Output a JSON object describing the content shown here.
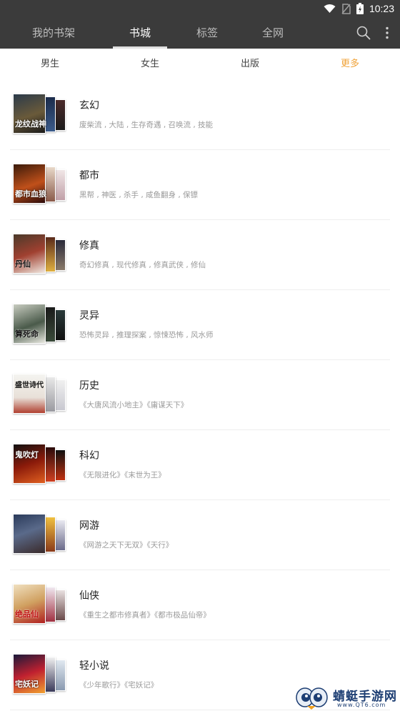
{
  "status_bar": {
    "time": "10:23"
  },
  "nav": {
    "tabs": [
      {
        "label": "我的书架",
        "active": false
      },
      {
        "label": "书城",
        "active": true
      },
      {
        "label": "标签",
        "active": false
      },
      {
        "label": "全网",
        "active": false
      }
    ],
    "actions": [
      "search-icon",
      "more-vert-icon"
    ]
  },
  "categories": {
    "tabs": [
      {
        "label": "男生"
      },
      {
        "label": "女生"
      },
      {
        "label": "出版"
      },
      {
        "label": "更多"
      }
    ]
  },
  "genres": [
    {
      "title": "玄幻",
      "tags": "废柴流 , 大陆 , 生存奇遇 , 召唤流 , 技能",
      "cover_text": "龙纹战神"
    },
    {
      "title": "都市",
      "tags": "黑帮 , 神医 , 杀手 , 咸鱼翻身 , 保镖",
      "cover_text": "都市血狼"
    },
    {
      "title": "修真",
      "tags": "奇幻修真 , 现代修真 , 修真武侠 , 修仙",
      "cover_text": "丹仙"
    },
    {
      "title": "灵异",
      "tags": "恐怖灵异 , 推理探案 , 惊悚恐怖 , 风水师",
      "cover_text": "算死命"
    },
    {
      "title": "历史",
      "tags": "《大唐风流小地主》《庸谋天下》",
      "cover_text": "盛世诗代"
    },
    {
      "title": "科幻",
      "tags": "《无限进化》《末世为王》",
      "cover_text": "鬼吹灯"
    },
    {
      "title": "网游",
      "tags": "《网游之天下无双》《天行》",
      "cover_text": ""
    },
    {
      "title": "仙侠",
      "tags": "《重生之都市修真者》《都市极品仙帝》",
      "cover_text": "绝品仙"
    },
    {
      "title": "轻小说",
      "tags": "《少年歌行》《宅妖记》",
      "cover_text": "宅妖记"
    }
  ],
  "watermark": {
    "title": "蜻蜓手游网",
    "url": "www.QT6.com"
  },
  "colors": {
    "header_bg": "#3b3b3b",
    "accent_more": "#f0a33a",
    "text_primary": "#222222",
    "text_secondary": "#9a9a9a"
  }
}
